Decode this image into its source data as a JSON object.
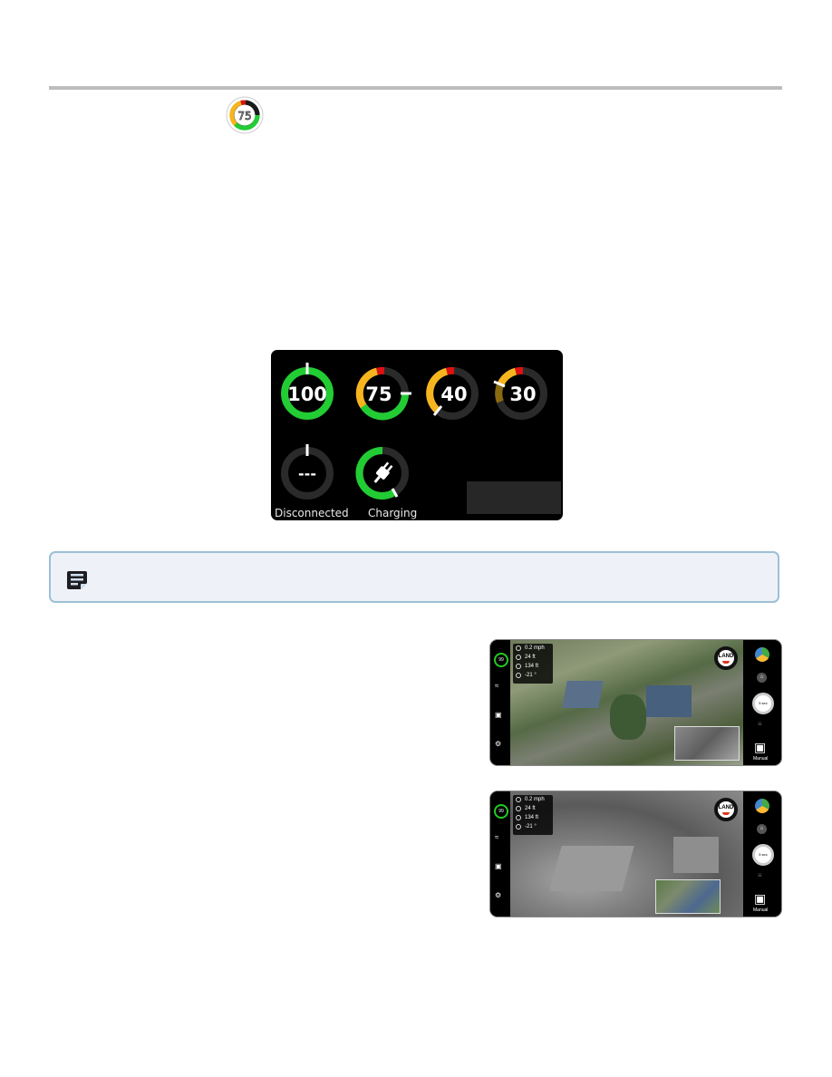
{
  "header": {
    "divider": true
  },
  "inline_gauge": {
    "value": "75",
    "icon": "battery-gauge-icon"
  },
  "gauge_panel": {
    "gauges": [
      {
        "value": "100",
        "percent": 100,
        "state": "full",
        "colors": [
          "#22cc33"
        ]
      },
      {
        "value": "75",
        "percent": 75,
        "state": "normal",
        "colors": [
          "#22cc33",
          "#f6b51e",
          "#dd1111"
        ]
      },
      {
        "value": "40",
        "percent": 40,
        "state": "low",
        "colors": [
          "#f6b51e",
          "#dd1111"
        ]
      },
      {
        "value": "30",
        "percent": 30,
        "state": "critical",
        "colors": [
          "#8a6a10",
          "#f6b51e",
          "#dd1111"
        ]
      },
      {
        "value": "---",
        "percent": 0,
        "state": "disconnected",
        "label": "Disconnected"
      },
      {
        "value": "",
        "percent": 65,
        "state": "charging",
        "label": "Charging",
        "icon": "plug-icon"
      }
    ]
  },
  "note": {
    "icon": "note-icon",
    "text": ""
  },
  "screenshots": [
    {
      "mode": "visual",
      "telemetry": {
        "speed": "0.2 mph",
        "distance": "24 ft",
        "altitude": "134 ft",
        "gimbal": "-21 °"
      },
      "battery": "99",
      "land_label": "LAND",
      "land_caption": "HOLD TO",
      "timer": "5 sec",
      "control_mode": "Manual"
    },
    {
      "mode": "thermal",
      "telemetry": {
        "speed": "0.2 mph",
        "distance": "24 ft",
        "altitude": "134 ft",
        "gimbal": "-21 °"
      },
      "battery": "99",
      "land_label": "LAND",
      "land_caption": "HOLD TO",
      "timer": "5 sec",
      "control_mode": "Manual"
    }
  ]
}
